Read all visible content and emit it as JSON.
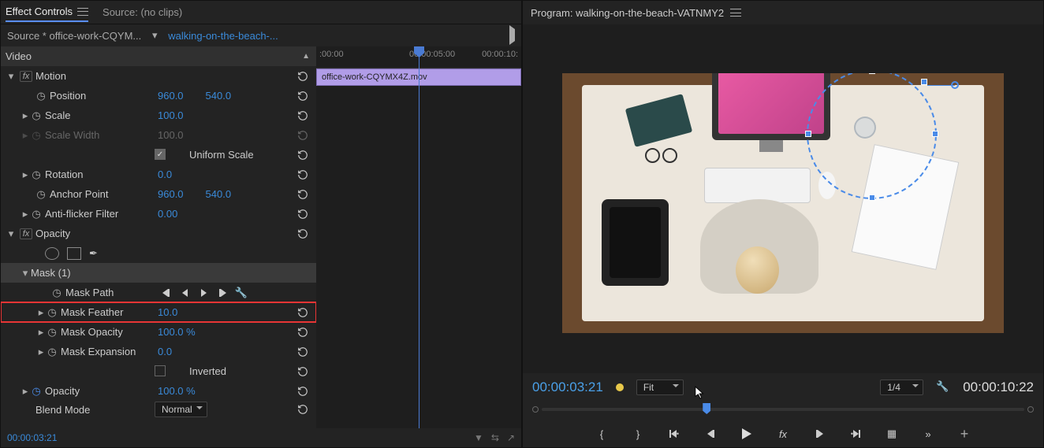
{
  "left_panel": {
    "tab_title": "Effect Controls",
    "source_label": "Source: (no clips)",
    "source_clip": "Source * office-work-CQYM...",
    "sequence_link": "walking-on-the-beach-...",
    "video_header": "Video",
    "motion": {
      "label": "Motion",
      "position": {
        "label": "Position",
        "x": "960.0",
        "y": "540.0"
      },
      "scale": {
        "label": "Scale",
        "value": "100.0"
      },
      "scale_width": {
        "label": "Scale Width",
        "value": "100.0"
      },
      "uniform": {
        "label": "Uniform Scale"
      },
      "rotation": {
        "label": "Rotation",
        "value": "0.0"
      },
      "anchor": {
        "label": "Anchor Point",
        "x": "960.0",
        "y": "540.0"
      },
      "antiflicker": {
        "label": "Anti-flicker Filter",
        "value": "0.00"
      }
    },
    "opacity": {
      "label": "Opacity",
      "mask_label": "Mask (1)",
      "mask_path": {
        "label": "Mask Path"
      },
      "mask_feather": {
        "label": "Mask Feather",
        "value": "10.0"
      },
      "mask_opacity": {
        "label": "Mask Opacity",
        "value": "100.0 %"
      },
      "mask_expansion": {
        "label": "Mask Expansion",
        "value": "0.0"
      },
      "inverted": {
        "label": "Inverted"
      },
      "opacity_prop": {
        "label": "Opacity",
        "value": "100.0 %"
      },
      "blend": {
        "label": "Blend Mode",
        "value": "Normal"
      }
    },
    "timeline": {
      "t0": ":00:00",
      "t1": "00:00:05:00",
      "t2": "00:00:10:",
      "clip_name": "office-work-CQYMX4Z.mov"
    },
    "footer_time": "00:00:03:21"
  },
  "right_panel": {
    "title": "Program: walking-on-the-beach-VATNMY2",
    "timecode": "00:00:03:21",
    "fit_label": "Fit",
    "res_label": "1/4",
    "duration": "00:00:10:22"
  }
}
